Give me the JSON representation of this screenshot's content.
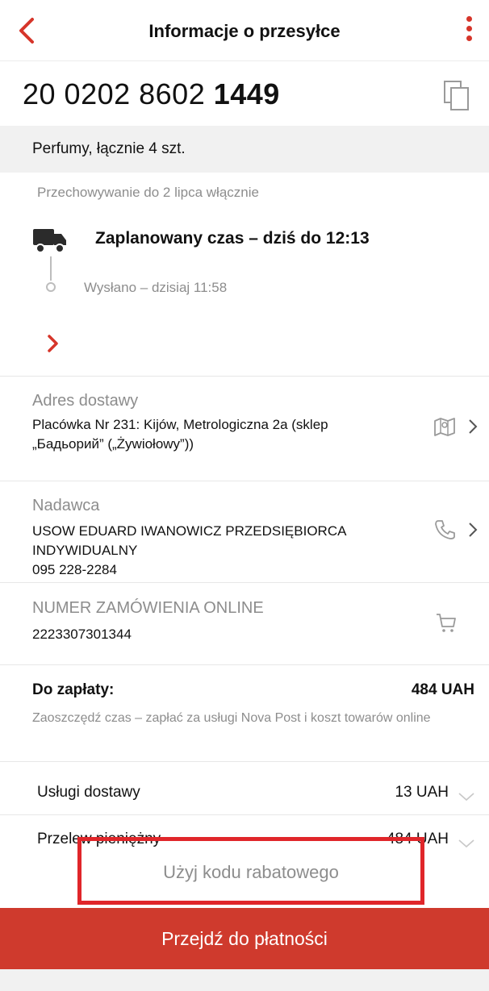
{
  "header": {
    "title": "Informacje o przesyłce",
    "back_icon": "chevron-left-icon",
    "menu_icon": "more-vertical-icon"
  },
  "parcel": {
    "tracking_prefix": "20 0202 8602 ",
    "tracking_suffix": "1449",
    "copy_icon": "copy-icon",
    "description": "Perfumy, łącznie 4 szt.",
    "storage": "Przechowywanie do 2 lipca włącznie"
  },
  "timeline": {
    "planned": "Zaplanowany czas – dziś do 12:13",
    "sent": "Wysłano – dzisiaj 11:58",
    "truck_icon": "truck-icon",
    "expand_icon": "chevron-right-icon"
  },
  "address": {
    "label": "Adres dostawy",
    "line1": "Placówka Nr 231: Kijów, Metrologiczna 2a (sklep",
    "line2": "„Бадьорий” („Żywiołowy”))",
    "icon": "map-icon"
  },
  "sender": {
    "label": "Nadawca",
    "line1": "USOW EDUARD IWANOWICZ PRZEDSIĘBIORCA",
    "line2": "INDYWIDUALNY",
    "phone": "095 228-2284",
    "icon": "phone-icon"
  },
  "order": {
    "label": "NUMER ZAMÓWIENIA ONLINE",
    "number": "2223307301344",
    "icon": "cart-icon"
  },
  "payment": {
    "label": "Do zapłaty:",
    "amount": "484 UAH",
    "note": "Zaoszczędź czas – zapłać za usługi Nova Post i koszt towarów online",
    "items": [
      {
        "label": "Usługi dostawy",
        "amount": "13 UAH"
      },
      {
        "label": "Przelew pieniężny",
        "amount": "484 UAH"
      }
    ]
  },
  "promo": {
    "label": "Użyj kodu rabatowego"
  },
  "cta": {
    "label": "Przejdź do płatności"
  },
  "colors": {
    "accent": "#cf3a2d",
    "highlight": "#e0262a",
    "muted": "#8d8d8d",
    "band": "#f1f1f1"
  }
}
